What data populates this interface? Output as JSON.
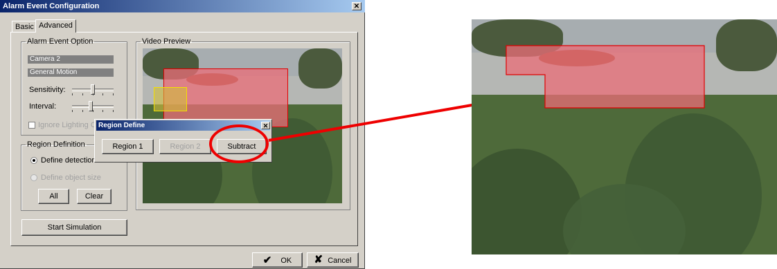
{
  "window": {
    "title": "Alarm Event Configuration",
    "close_glyph": "✕"
  },
  "tabs": [
    {
      "label": "Basic"
    },
    {
      "label": "Advanced"
    }
  ],
  "alarm_event_option": {
    "legend": "Alarm Event Option",
    "camera": "Camera 2",
    "event": "General Motion",
    "sensitivity_label": "Sensitivity:",
    "sensitivity_level": 0.5,
    "interval_label": "Interval:",
    "interval_level": 0.45,
    "ignore_lighting_label": "Ignore Lighting C"
  },
  "region_definition": {
    "legend": "Region Definition",
    "define_detection_label": "Define detection r",
    "define_object_size_label": "Define object size",
    "all_label": "All",
    "clear_label": "Clear"
  },
  "video_preview": {
    "legend": "Video Preview"
  },
  "start_simulation_label": "Start Simulation",
  "footer": {
    "ok_label": "OK",
    "cancel_label": "Cancel",
    "ok_icon": "checkmark-icon",
    "cancel_icon": "x-icon"
  },
  "region_define_popup": {
    "title": "Region Define",
    "close_glyph": "✕",
    "region1_label": "Region 1",
    "region2_label": "Region 2",
    "subtract_label": "Subtract"
  },
  "annotation": {
    "color": "#ee0000",
    "arrow": "red-arrow"
  }
}
